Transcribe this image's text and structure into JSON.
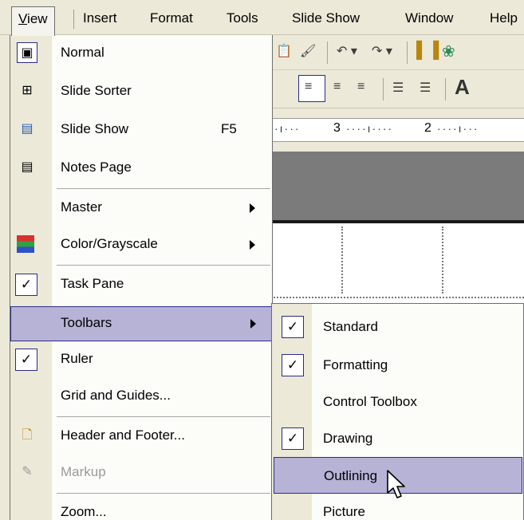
{
  "menubar": {
    "items": [
      {
        "label": "View",
        "key": "V"
      },
      {
        "label": "Insert",
        "key": "I"
      },
      {
        "label": "Format",
        "key": "o"
      },
      {
        "label": "Tools",
        "key": "T"
      },
      {
        "label": "Slide Show",
        "key": "d"
      },
      {
        "label": "Window",
        "key": "W"
      },
      {
        "label": "Help",
        "key": "H"
      }
    ]
  },
  "view_menu": {
    "items": [
      {
        "label": "Normal",
        "icon": "normal-view-icon"
      },
      {
        "label": "Slide Sorter",
        "icon": "slide-sorter-icon"
      },
      {
        "label": "Slide Show",
        "shortcut": "F5",
        "icon": "slide-show-icon"
      },
      {
        "label": "Notes Page",
        "icon": "notes-page-icon"
      },
      {
        "label": "Master",
        "submenu": true
      },
      {
        "label": "Color/Grayscale",
        "submenu": true,
        "icon": "color-grayscale-icon"
      },
      {
        "label": "Task Pane",
        "checked": true
      },
      {
        "label": "Toolbars",
        "submenu": true,
        "highlighted": true
      },
      {
        "label": "Ruler",
        "checked": true
      },
      {
        "label": "Grid and Guides..."
      },
      {
        "label": "Header and Footer...",
        "icon": "header-footer-icon"
      },
      {
        "label": "Markup",
        "disabled": true,
        "icon": "markup-icon"
      },
      {
        "label": "Zoom..."
      }
    ]
  },
  "toolbars_menu": {
    "items": [
      {
        "label": "Standard",
        "checked": true
      },
      {
        "label": "Formatting",
        "checked": true
      },
      {
        "label": "Control Toolbox",
        "checked": false
      },
      {
        "label": "Drawing",
        "checked": true
      },
      {
        "label": "Outlining",
        "checked": false,
        "highlighted": true
      },
      {
        "label": "Picture",
        "checked": false
      }
    ]
  },
  "ruler": {
    "marks": [
      "3",
      "2"
    ]
  },
  "colors": {
    "menu_bg": "#ece9d8",
    "highlight": "#b6b3d6",
    "highlight_border": "#2c2c8a"
  }
}
